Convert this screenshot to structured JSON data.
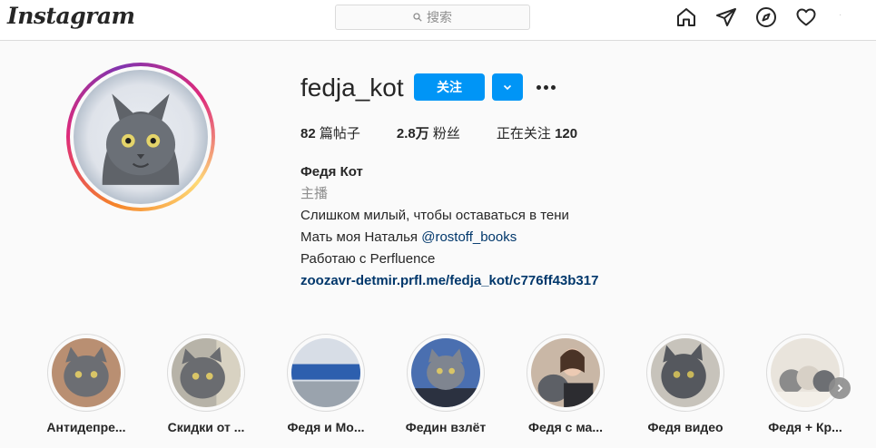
{
  "header": {
    "logo_text": "Instagram",
    "search_placeholder": "搜索",
    "icons": [
      "home-icon",
      "direct-message-icon",
      "explore-icon",
      "activity-heart-icon"
    ]
  },
  "profile": {
    "username": "fedja_kot",
    "follow_label": "关注",
    "dropdown_icon": "chevron-down-icon",
    "more_icon": "more-options-icon",
    "stats": {
      "posts_count": "82",
      "posts_label": " 篇帖子",
      "followers_count": "2.8万",
      "followers_label": " 粉丝",
      "following_label": "正在关注 ",
      "following_count": "120"
    },
    "bio": {
      "name": "Федя Кот",
      "category": "主播",
      "line1": "Слишком милый, чтобы оставаться в тени",
      "line2_text": "Мать моя Наталья ",
      "line2_mention": "@rostoff_books",
      "line3": "Работаю с Perfluence",
      "website": "zoozavr-detmir.prfl.me/fedja_kot/c776ff43b317"
    }
  },
  "highlights": [
    {
      "label": "Антидепре..."
    },
    {
      "label": "Скидки от ..."
    },
    {
      "label": "Федя и Мо..."
    },
    {
      "label": "Федин взлёт"
    },
    {
      "label": "Федя с ма..."
    },
    {
      "label": "Федя видео"
    },
    {
      "label": "Федя + Кр..."
    }
  ],
  "colors": {
    "accent_blue": "#0095f6",
    "link_blue": "#00376b",
    "secondary_text": "#8e8e8e",
    "border": "#dbdbdb"
  }
}
